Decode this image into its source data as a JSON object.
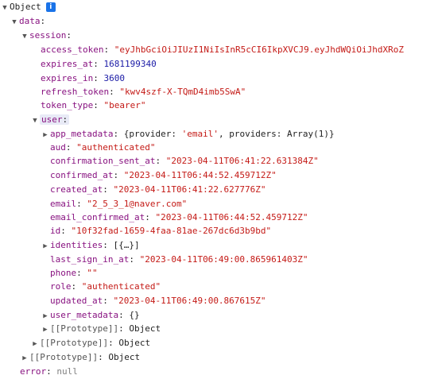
{
  "root": {
    "label": "Object",
    "info_icon": "i"
  },
  "data_key": "data",
  "session_key": "session",
  "session": {
    "access_token": {
      "key": "access_token",
      "value": "\"eyJhbGciOiJIUzI1NiIsInR5cCI6IkpXVCJ9.eyJhdWQiOiJhdXRoZ"
    },
    "expires_at": {
      "key": "expires_at",
      "value": "1681199340"
    },
    "expires_in": {
      "key": "expires_in",
      "value": "3600"
    },
    "refresh_token": {
      "key": "refresh_token",
      "value": "\"kwv4szf-X-TQmD4imb5SwA\""
    },
    "token_type": {
      "key": "token_type",
      "value": "\"bearer\""
    }
  },
  "user_key": "user",
  "user": {
    "app_metadata": {
      "key": "app_metadata",
      "pre": "{provider: ",
      "prov": "'email'",
      "post": ", providers: Array(1)}"
    },
    "aud": {
      "key": "aud",
      "value": "\"authenticated\""
    },
    "confirmation_sent_at": {
      "key": "confirmation_sent_at",
      "value": "\"2023-04-11T06:41:22.631384Z\""
    },
    "confirmed_at": {
      "key": "confirmed_at",
      "value": "\"2023-04-11T06:44:52.459712Z\""
    },
    "created_at": {
      "key": "created_at",
      "value": "\"2023-04-11T06:41:22.627776Z\""
    },
    "email": {
      "key": "email",
      "value": "\"2_5_3_1@naver.com\""
    },
    "email_confirmed_at": {
      "key": "email_confirmed_at",
      "value": "\"2023-04-11T06:44:52.459712Z\""
    },
    "id": {
      "key": "id",
      "value": "\"10f32fad-1659-4faa-81ae-267dc6d3b9bd\""
    },
    "identities": {
      "key": "identities",
      "value": "[{…}]"
    },
    "last_sign_in_at": {
      "key": "last_sign_in_at",
      "value": "\"2023-04-11T06:49:00.865961403Z\""
    },
    "phone": {
      "key": "phone",
      "value": "\"\""
    },
    "role": {
      "key": "role",
      "value": "\"authenticated\""
    },
    "updated_at": {
      "key": "updated_at",
      "value": "\"2023-04-11T06:49:00.867615Z\""
    },
    "user_metadata": {
      "key": "user_metadata",
      "value": "{}"
    }
  },
  "prototype": {
    "key": "[[Prototype]]",
    "value": "Object"
  },
  "error": {
    "key": "error",
    "value": "null"
  }
}
